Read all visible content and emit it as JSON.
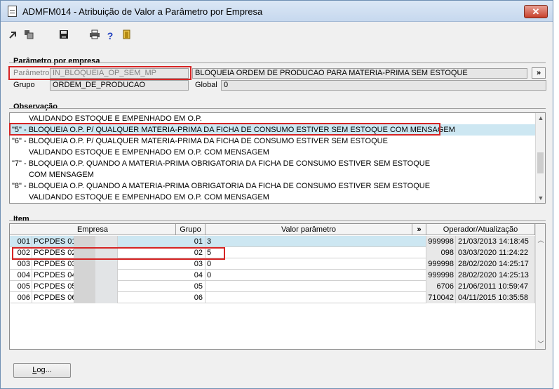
{
  "window": {
    "title": "ADMFM014 - Atribuição de Valor a Parâmetro por Empresa",
    "close_label": "✕"
  },
  "toolbar": {
    "icons": [
      "arrow-icon",
      "copy-icon",
      "save-icon",
      "print-icon",
      "help-icon",
      "exit-icon"
    ]
  },
  "param_group": {
    "title": "Parâmetro por empresa",
    "parametro_label": "Parâmetro",
    "parametro_value": "IN_BLOQUEIA_OP_SEM_MP",
    "parametro_desc": "BLOQUEIA ORDEM DE PRODUCAO PARA MATERIA-PRIMA SEM ESTOQUE",
    "expand_label": "»",
    "grupo_label": "Grupo",
    "grupo_value": "ORDEM_DE_PRODUCAO",
    "global_label": "Global",
    "global_value": "0"
  },
  "obs_group": {
    "title": "Observação",
    "lines": [
      "VALIDANDO ESTOQUE E EMPENHADO EM O.P.",
      "\"5\" - BLOQUEIA O.P. P/ QUALQUER MATERIA-PRIMA DA FICHA DE CONSUMO ESTIVER SEM ESTOQUE COM MENSAGEM",
      "\"6\" - BLOQUEIA O.P. P/ QUALQUER MATERIA-PRIMA DA FICHA DE CONSUMO ESTIVER SEM ESTOQUE",
      "VALIDANDO ESTOQUE E EMPENHADO EM O.P. COM MENSAGEM",
      "\"7\" - BLOQUEIA O.P. QUANDO A MATERIA-PRIMA OBRIGATORIA DA FICHA DE CONSUMO ESTIVER SEM ESTOQUE",
      "COM MENSAGEM",
      "\"8\" - BLOQUEIA O.P. QUANDO A MATERIA-PRIMA OBRIGATORIA DA FICHA DE CONSUMO ESTIVER SEM ESTOQUE",
      "VALIDANDO ESTOQUE E EMPENHADO EM O.P. COM MENSAGEM"
    ]
  },
  "item_group": {
    "title": "Item",
    "columns": {
      "empresa": "Empresa",
      "grupo": "Grupo",
      "valor": "Valor parâmetro",
      "expand": "»",
      "operador": "Operador/Atualização"
    },
    "rows": [
      {
        "cod": "001",
        "empresa": "PCPDES 01",
        "grupo": "01",
        "valor": "3",
        "operador": "999998",
        "data": "21/03/2013 14:18:45"
      },
      {
        "cod": "002",
        "empresa": "PCPDES 02",
        "grupo": "02",
        "valor": "5",
        "operador": "098",
        "data": "03/03/2020 11:24:22"
      },
      {
        "cod": "003",
        "empresa": "PCPDES 03",
        "grupo": "03",
        "valor": "0",
        "operador": "999998",
        "data": "28/02/2020 14:25:17"
      },
      {
        "cod": "004",
        "empresa": "PCPDES 04",
        "grupo": "04",
        "valor": "0",
        "operador": "999998",
        "data": "28/02/2020 14:25:13"
      },
      {
        "cod": "005",
        "empresa": "PCPDES 05",
        "grupo": "05",
        "valor": "",
        "operador": "6706",
        "data": "21/06/2011 10:59:47"
      },
      {
        "cod": "006",
        "empresa": "PCPDES 06",
        "grupo": "06",
        "valor": "",
        "operador": "710042",
        "data": "04/11/2015 10:35:58"
      }
    ]
  },
  "log_button": {
    "label_l": "L",
    "label_rest": "og..."
  },
  "colors": {
    "highlight": "#cde7f2",
    "annotation": "#d62424"
  }
}
